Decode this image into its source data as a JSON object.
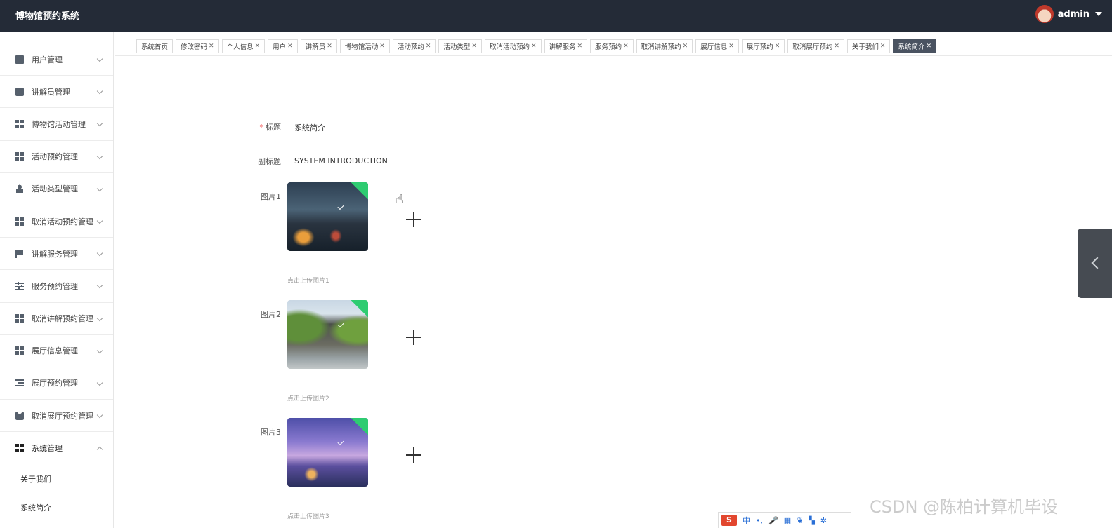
{
  "app": {
    "title": "博物馆预约系统",
    "user": "admin"
  },
  "sidebar": {
    "items": [
      {
        "label": "用户管理",
        "icon": "clipboard-icon"
      },
      {
        "label": "讲解员管理",
        "icon": "chat-icon"
      },
      {
        "label": "博物馆活动管理",
        "icon": "grid-icon"
      },
      {
        "label": "活动预约管理",
        "icon": "grid-icon"
      },
      {
        "label": "活动类型管理",
        "icon": "person-icon"
      },
      {
        "label": "取消活动预约管理",
        "icon": "grid-icon"
      },
      {
        "label": "讲解服务管理",
        "icon": "flag-icon"
      },
      {
        "label": "服务预约管理",
        "icon": "sliders-icon"
      },
      {
        "label": "取消讲解预约管理",
        "icon": "grid-icon"
      },
      {
        "label": "展厅信息管理",
        "icon": "grid-icon"
      },
      {
        "label": "展厅预约管理",
        "icon": "list-icon"
      },
      {
        "label": "取消展厅预约管理",
        "icon": "ticket-icon"
      },
      {
        "label": "系统管理",
        "icon": "grid-icon"
      }
    ],
    "sub_items": [
      "关于我们",
      "系统简介"
    ]
  },
  "tabs": [
    {
      "label": "系统首页",
      "closable": false
    },
    {
      "label": "修改密码",
      "closable": true
    },
    {
      "label": "个人信息",
      "closable": true
    },
    {
      "label": "用户",
      "closable": true
    },
    {
      "label": "讲解员",
      "closable": true
    },
    {
      "label": "博物馆活动",
      "closable": true
    },
    {
      "label": "活动预约",
      "closable": true
    },
    {
      "label": "活动类型",
      "closable": true
    },
    {
      "label": "取消活动预约",
      "closable": true
    },
    {
      "label": "讲解服务",
      "closable": true
    },
    {
      "label": "服务预约",
      "closable": true
    },
    {
      "label": "取消讲解预约",
      "closable": true
    },
    {
      "label": "展厅信息",
      "closable": true
    },
    {
      "label": "展厅预约",
      "closable": true
    },
    {
      "label": "取消展厅预约",
      "closable": true
    },
    {
      "label": "关于我们",
      "closable": true
    },
    {
      "label": "系统简介",
      "closable": true,
      "active": true
    }
  ],
  "tab_close": "✕",
  "form": {
    "title_label": "标题",
    "required_mark": "*",
    "title_value": "系统简介",
    "subtitle_label": "副标题",
    "subtitle_value": "SYSTEM INTRODUCTION",
    "pictures": [
      {
        "label": "图片1",
        "hint": "点击上传图片1"
      },
      {
        "label": "图片2",
        "hint": "点击上传图片2"
      },
      {
        "label": "图片3",
        "hint": "点击上传图片3"
      }
    ]
  },
  "watermark": "CSDN @陈柏计算机毕设",
  "ime": {
    "logo": "S",
    "mode": "中"
  },
  "colors": {
    "topbar": "#242b37",
    "active_tab": "#4a5361",
    "required": "#f56c6c",
    "upload_success": "#2ecc71"
  }
}
